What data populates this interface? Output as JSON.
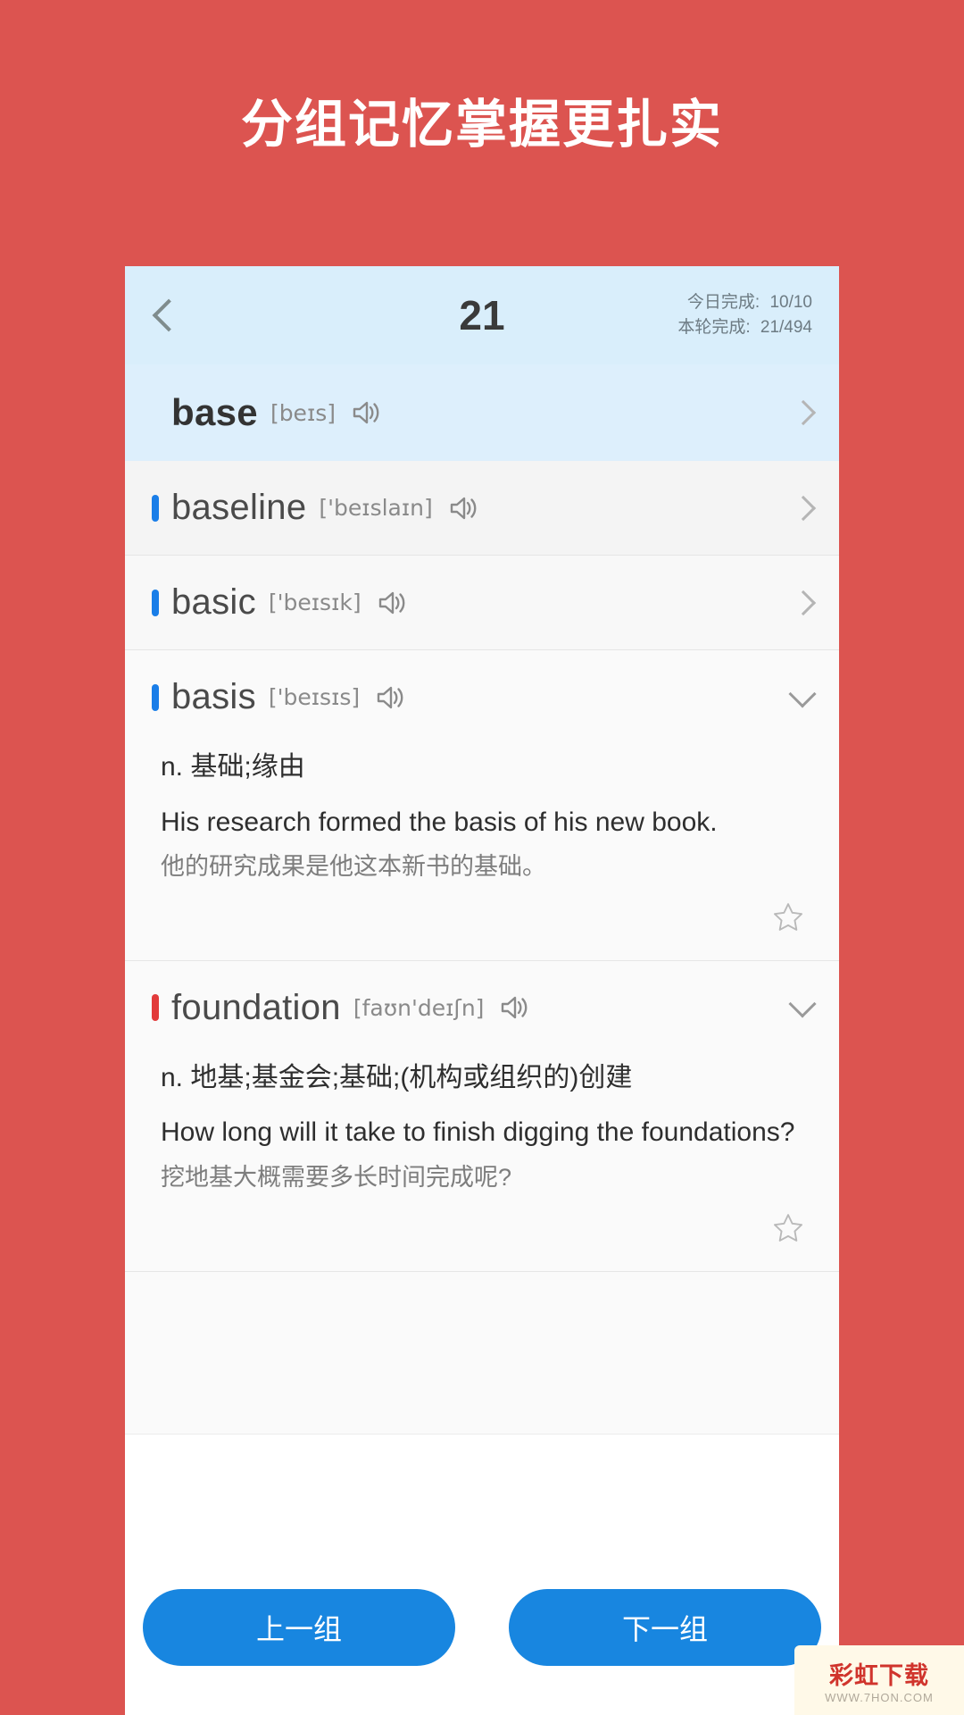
{
  "banner": {
    "title": "分组记忆掌握更扎实"
  },
  "header": {
    "back_icon": "chevron-left-icon",
    "title": "21",
    "stats": [
      {
        "label": "今日完成:",
        "value": "10/10"
      },
      {
        "label": "本轮完成:",
        "value": "21/494"
      }
    ]
  },
  "words": [
    {
      "word": "base",
      "phonetic": "[beɪs]",
      "marker": "none",
      "expanded": false,
      "current": true,
      "chevron": "chevron-right-icon"
    },
    {
      "word": "baseline",
      "phonetic": "['beɪslaɪn]",
      "marker": "blue",
      "expanded": false,
      "current": false,
      "chevron": "chevron-right-icon"
    },
    {
      "word": "basic",
      "phonetic": "['beɪsɪk]",
      "marker": "blue",
      "expanded": false,
      "current": false,
      "chevron": "chevron-right-icon"
    },
    {
      "word": "basis",
      "phonetic": "['beɪsɪs]",
      "marker": "blue",
      "expanded": true,
      "current": false,
      "chevron": "chevron-down-icon",
      "definition": "n. 基础;缘由",
      "example_en": "His research formed the basis of his new book.",
      "example_cn": "他的研究成果是他这本新书的基础。",
      "star_icon": "star-outline-icon"
    },
    {
      "word": "foundation",
      "phonetic": "[faʊn'deɪʃn]",
      "marker": "red",
      "expanded": true,
      "current": false,
      "chevron": "chevron-down-icon",
      "definition": "n. 地基;基金会;基础;(机构或组织的)创建",
      "example_en": "How long will it take to finish digging the foundations?",
      "example_cn": "挖地基大概需要多长时间完成呢?",
      "star_icon": "star-outline-icon"
    }
  ],
  "bottom": {
    "prev_label": "上一组",
    "next_label": "下一组"
  },
  "watermark": {
    "main": "彩虹下载",
    "sub": "WWW.7HON.COM"
  },
  "colors": {
    "background": "#dc5450",
    "accent": "#1886e0",
    "current_row": "#ddeffc",
    "marker_blue": "#1a7ee8",
    "marker_red": "#e23b3b"
  }
}
